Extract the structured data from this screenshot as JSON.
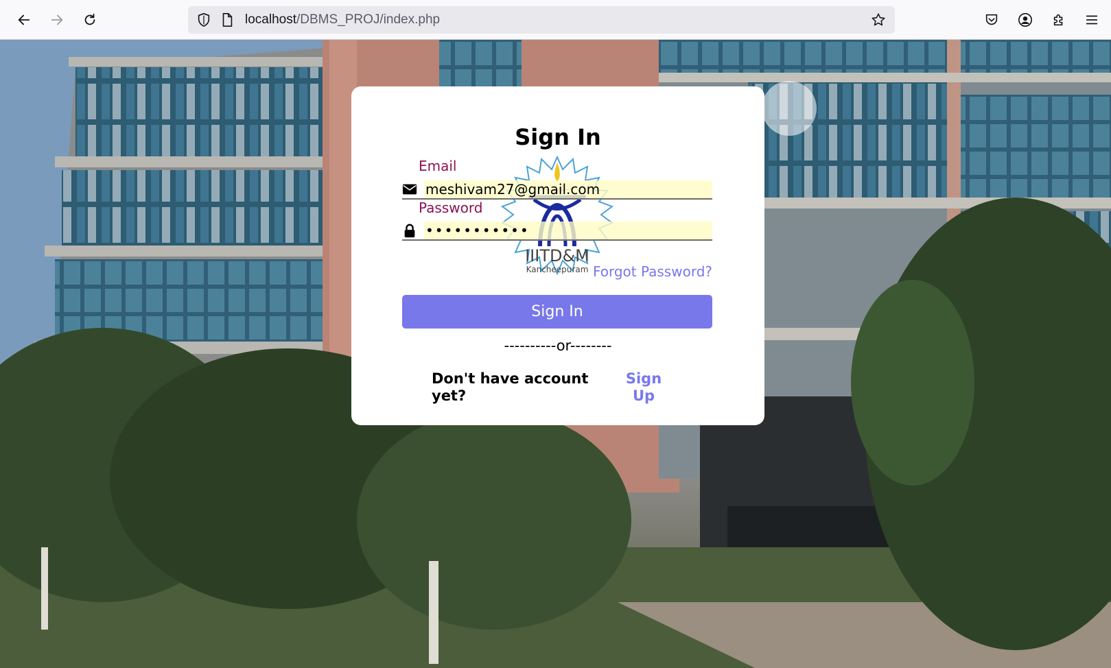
{
  "browser": {
    "url_host": "localhost",
    "url_path": "/DBMS_PROJ/index.php"
  },
  "card": {
    "title": "Sign In",
    "logo": {
      "text": "IIITD&M",
      "subtext": "Kancheepuram"
    },
    "email": {
      "label": "Email",
      "value": "meshivam27@gmail.com"
    },
    "password": {
      "label": "Password",
      "masked_value": "•••••••••••"
    },
    "forgot_label": "Forgot Password?",
    "signin_label": "Sign In",
    "divider": "----------or--------",
    "no_account_text": "Don't have account yet?",
    "signup_label": "Sign Up"
  },
  "colors": {
    "accent": "#7878ea",
    "label": "#8a1255",
    "link": "#7777ee"
  }
}
